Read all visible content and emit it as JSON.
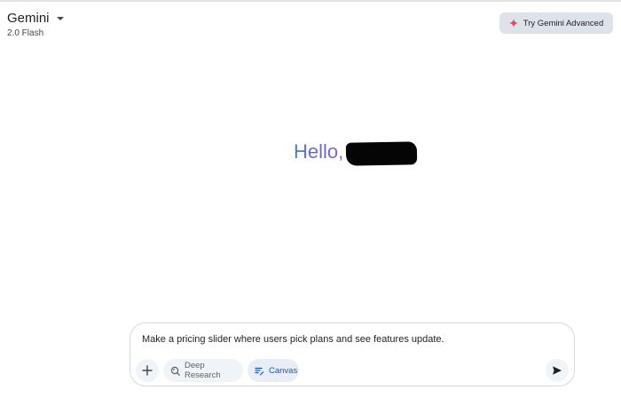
{
  "header": {
    "model_name": "Gemini",
    "model_version": "2.0 Flash",
    "advanced_button_label": "Try Gemini Advanced"
  },
  "greeting": {
    "text": "Hello,"
  },
  "composer": {
    "prompt_text": "Make a pricing slider where users pick plans and see features update.",
    "tools": [
      {
        "label": "Deep Research",
        "icon": "deep-research-icon"
      },
      {
        "label": "Canvas",
        "icon": "canvas-icon"
      }
    ],
    "add_icon": "plus-icon",
    "send_icon": "send-icon"
  },
  "colors": {
    "advanced_button_bg": "#dde3ea",
    "spark_accent": "#e8445a",
    "canvas_accent": "#0b57d0",
    "greeting_gradient": [
      "#4d78d6",
      "#8f5fc5"
    ]
  }
}
